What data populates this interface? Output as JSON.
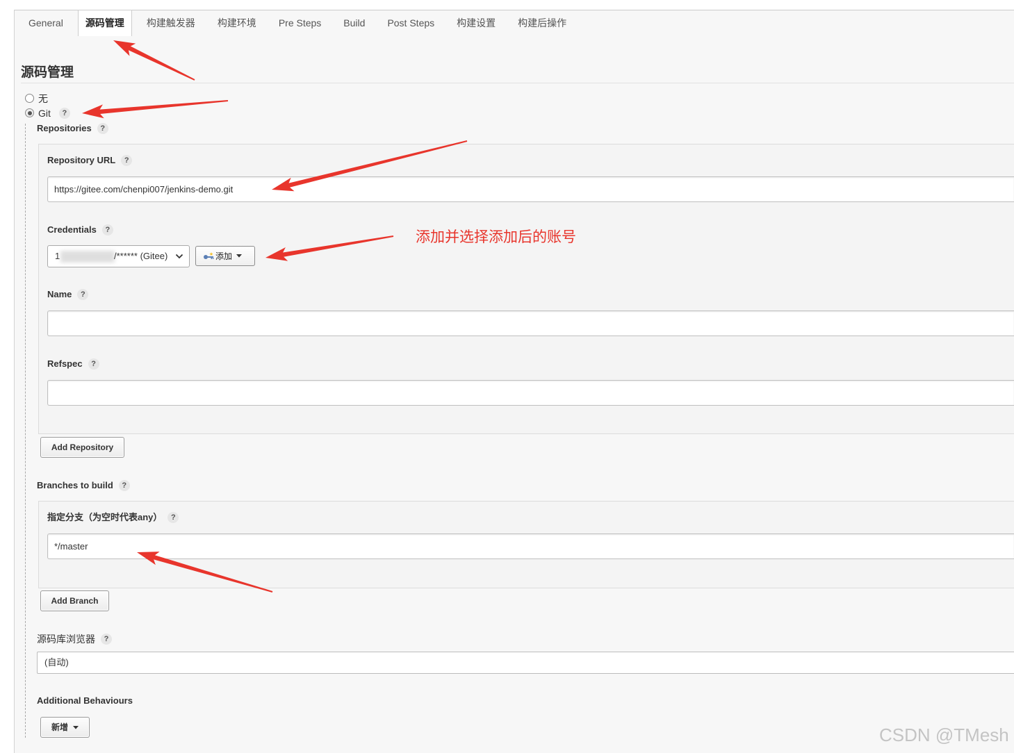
{
  "tabs": [
    {
      "label": "General",
      "active": false
    },
    {
      "label": "源码管理",
      "active": true
    },
    {
      "label": "构建触发器",
      "active": false
    },
    {
      "label": "构建环境",
      "active": false
    },
    {
      "label": "Pre Steps",
      "active": false
    },
    {
      "label": "Build",
      "active": false
    },
    {
      "label": "Post Steps",
      "active": false
    },
    {
      "label": "构建设置",
      "active": false
    },
    {
      "label": "构建后操作",
      "active": false
    }
  ],
  "help_glyph": "?",
  "section": {
    "title": "源码管理"
  },
  "scm_options": [
    {
      "label": "无",
      "checked": false
    },
    {
      "label": "Git",
      "checked": true
    }
  ],
  "repositories": {
    "label": "Repositories",
    "url": {
      "label": "Repository URL",
      "value": "https://gitee.com/chenpi007/jenkins-demo.git"
    },
    "credentials": {
      "label": "Credentials",
      "visible_prefix": "1",
      "visible_suffix": "/****** (Gitee)",
      "add_label": "添加"
    },
    "name": {
      "label": "Name"
    },
    "refspec": {
      "label": "Refspec"
    },
    "add_button": "Add Repository"
  },
  "branches": {
    "label": "Branches to build",
    "specifier": {
      "label": "指定分支（为空时代表any）",
      "value": "*/master"
    },
    "add_button": "Add Branch"
  },
  "browser": {
    "label": "源码库浏览器",
    "value": "(自动)"
  },
  "additional_behaviours": {
    "label": "Additional Behaviours",
    "add_button": "新增"
  },
  "annotation": {
    "text": "添加并选择添加后的账号"
  },
  "watermark": "CSDN @TMesh",
  "colors": {
    "annotation_red": "#e8352c",
    "panel_background": "#f7f7f7",
    "key_icon": "#5b7fb5"
  }
}
